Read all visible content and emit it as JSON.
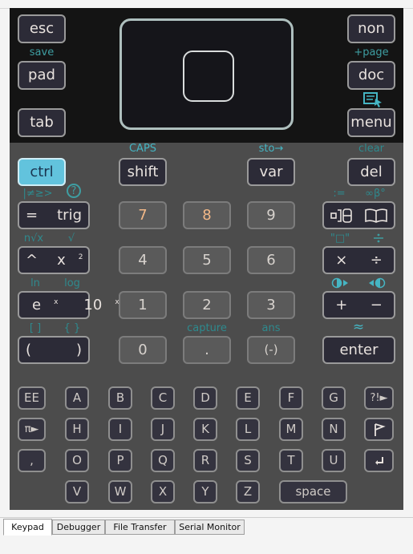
{
  "tabs": [
    {
      "label": "Keypad",
      "active": true
    },
    {
      "label": "Debugger",
      "active": false
    },
    {
      "label": "File Transfer",
      "active": false
    },
    {
      "label": "Serial Monitor",
      "active": false
    }
  ],
  "top_keys": {
    "esc": "esc",
    "pad": "pad",
    "tab": "tab",
    "on": "non",
    "doc": "doc",
    "menu": "menu"
  },
  "top_labels": {
    "save": "save",
    "page": "+page"
  },
  "mod_keys": {
    "ctrl": "ctrl",
    "shift": "shift",
    "var": "var",
    "del": "del"
  },
  "mod_labels": {
    "caps": "CAPS",
    "sto": "sto→",
    "clear": "clear",
    "relations": "|≠≥>",
    "help": "?",
    "assign": ":=",
    "infinity": "∞β°"
  },
  "left_keys": {
    "eq": "=",
    "trig": "trig",
    "caret": "^",
    "x": "x",
    "x_sup": "2",
    "e": "e",
    "e_sup": "x",
    "ten": "10",
    "ten_sup": "x",
    "lparen": "(",
    "rparen": ")"
  },
  "left_labels": {
    "nroot": "n√x",
    "sqrt": "√",
    "ln": "ln",
    "log": "log",
    "brackets": "[ ]",
    "braces": "{ }"
  },
  "num_keys": [
    "7",
    "8",
    "9",
    "4",
    "5",
    "6",
    "1",
    "2",
    "3",
    "0",
    ".",
    "(-)"
  ],
  "num_labels": {
    "capture": "capture",
    "ans": "ans"
  },
  "right_keys": {
    "times": "×",
    "divide": "÷",
    "plus": "+",
    "minus": "−",
    "enter": "enter"
  },
  "right_labels": {
    "quote": "\"□\"",
    "approx": "≈"
  },
  "letter_keys": {
    "ee": "EE",
    "row1": [
      "A",
      "B",
      "C",
      "D",
      "E",
      "F",
      "G"
    ],
    "punct": "?!►",
    "pi": "π►",
    "row2": [
      "H",
      "I",
      "J",
      "K",
      "L",
      "M",
      "N"
    ],
    "row3": [
      "O",
      "P",
      "Q",
      "R",
      "S",
      "T",
      "U"
    ],
    "row4": [
      "V",
      "W",
      "X",
      "Y",
      "Z"
    ],
    "comma": ",",
    "space": "space"
  },
  "colors": {
    "body": "#4c4c4c",
    "top_panel": "#141414",
    "key_dark": "#34333f",
    "key_num": "#5a5a5a",
    "ctrl_accent": "#62c3dd",
    "secondary_label": "#3e9ea2"
  }
}
